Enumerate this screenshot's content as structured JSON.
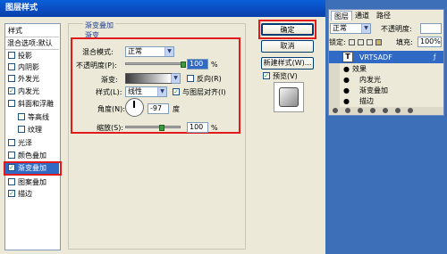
{
  "dialog": {
    "title": "图层样式",
    "close_symbol": "✕"
  },
  "style_list": {
    "header": "样式",
    "blend_options": "混合选项:默认",
    "items": [
      {
        "label": "投影",
        "checked": false
      },
      {
        "label": "内阴影",
        "checked": false
      },
      {
        "label": "外发光",
        "checked": false
      },
      {
        "label": "内发光",
        "checked": true
      },
      {
        "label": "斜面和浮雕",
        "checked": false
      },
      {
        "label": "等高线",
        "checked": false
      },
      {
        "label": "纹理",
        "checked": false
      },
      {
        "label": "光泽",
        "checked": false
      },
      {
        "label": "颜色叠加",
        "checked": false
      },
      {
        "label": "渐变叠加",
        "checked": true
      },
      {
        "label": "图案叠加",
        "checked": false
      },
      {
        "label": "描边",
        "checked": true
      }
    ],
    "check_mark": "✓"
  },
  "panel": {
    "group_title": "渐变叠加",
    "sub_title": "渐变",
    "blend_mode_label": "混合模式:",
    "blend_mode_value": "正常",
    "opacity_label": "不透明度(P):",
    "opacity_value": "100",
    "percent": "%",
    "gradient_label": "渐变:",
    "reverse_label": "反向(R)",
    "style_label": "样式(L):",
    "style_value": "线性",
    "align_label": "与图层对齐(I)",
    "angle_label": "角度(N):",
    "angle_value": "-97",
    "degree_unit": "度",
    "scale_label": "缩放(S):",
    "scale_value": "100"
  },
  "buttons": {
    "ok": "确定",
    "cancel": "取消",
    "new_style": "新建样式(W)...",
    "preview": "预览(V)"
  },
  "layers_panel": {
    "tabs": [
      "图层",
      "通道",
      "路径"
    ],
    "blend_mode": "正常",
    "opacity_label": "不透明度:",
    "lock_label": "锁定:",
    "fill_label": "填充:",
    "fill_value": "100%",
    "layer_name": "VRTSADF",
    "layer_type_glyph": "T",
    "effects_label": "效果",
    "effects": [
      "内发光",
      "渐变叠加",
      "描边"
    ]
  }
}
